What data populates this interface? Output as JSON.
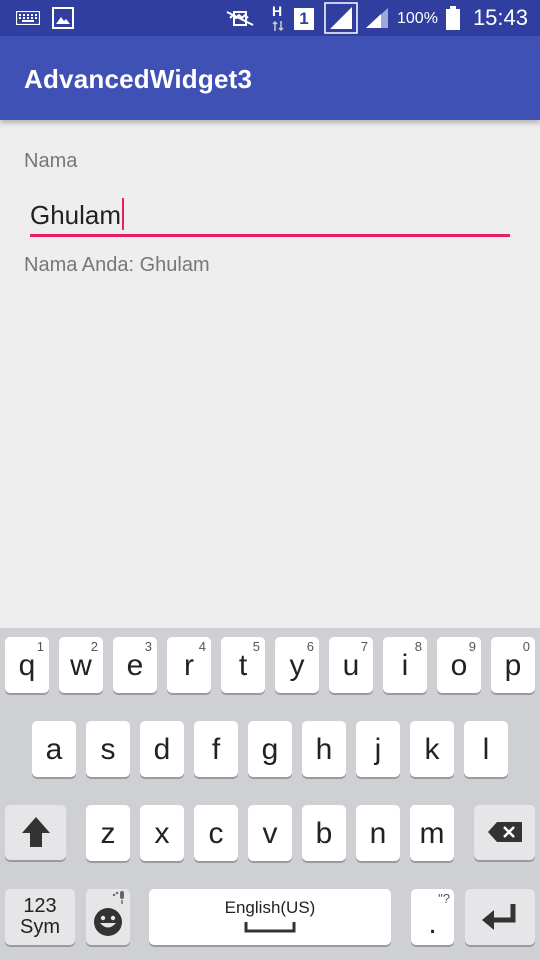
{
  "status_bar": {
    "battery_text": "100%",
    "time": "15:43",
    "network_h": "H",
    "sim_number": "1"
  },
  "app_bar": {
    "title": "AdvancedWidget3"
  },
  "form": {
    "label": "Nama",
    "input_value": "Ghulam",
    "result_text": "Nama Anda: Ghulam"
  },
  "keyboard": {
    "row1": [
      {
        "key": "q",
        "hint": "1"
      },
      {
        "key": "w",
        "hint": "2"
      },
      {
        "key": "e",
        "hint": "3"
      },
      {
        "key": "r",
        "hint": "4"
      },
      {
        "key": "t",
        "hint": "5"
      },
      {
        "key": "y",
        "hint": "6"
      },
      {
        "key": "u",
        "hint": "7"
      },
      {
        "key": "i",
        "hint": "8"
      },
      {
        "key": "o",
        "hint": "9"
      },
      {
        "key": "p",
        "hint": "0"
      }
    ],
    "row2": [
      "a",
      "s",
      "d",
      "f",
      "g",
      "h",
      "j",
      "k",
      "l"
    ],
    "row3": [
      "z",
      "x",
      "c",
      "v",
      "b",
      "n",
      "m"
    ],
    "sym_line1": "123",
    "sym_line2": "Sym",
    "space_label": "English(US)",
    "period_key": ".",
    "period_hint": "\"?",
    "icons": {
      "shift": "shift-icon",
      "backspace": "backspace-icon",
      "emoji": "emoji-icon",
      "enter": "enter-icon",
      "mic": "mic-icon"
    }
  },
  "colors": {
    "status_bar": "#303f9f",
    "app_bar": "#3f51b5",
    "accent": "#e91e63",
    "background": "#eeeeee"
  }
}
